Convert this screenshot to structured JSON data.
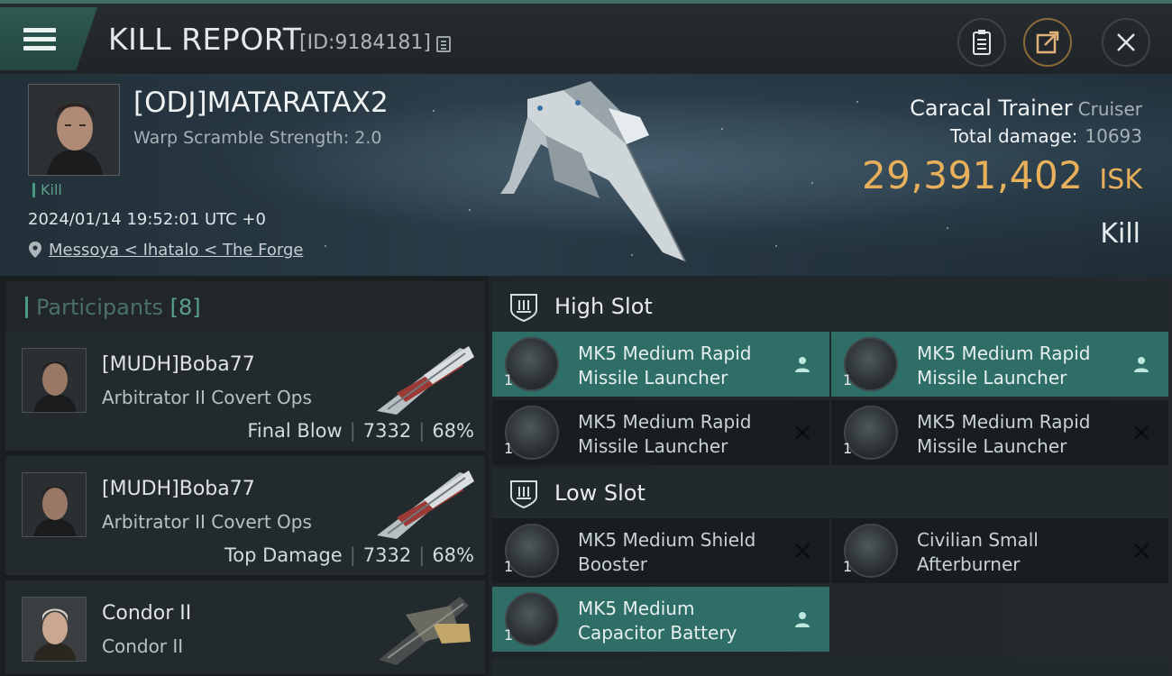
{
  "header": {
    "title": "KILL REPORT",
    "report_id": "[ID:9184181]"
  },
  "victim": {
    "name": "[ODJ]MATARATAX2",
    "warp_scramble": "Warp Scramble Strength: 2.0",
    "tag": "Kill",
    "datetime": "2024/01/14 19:52:01 UTC +0",
    "location": "Messoya < Ihatalo < The Forge",
    "ship_name": "Caracal Trainer",
    "ship_class": "Cruiser",
    "total_damage_label": "Total damage:",
    "total_damage": "10693",
    "isk_value": "29,391,402",
    "isk_unit": "ISK",
    "result": "Kill"
  },
  "participants": {
    "label": "Participants",
    "count": "[8]",
    "items": [
      {
        "name": "[MUDH]Boba77",
        "ship": "Arbitrator II Covert Ops",
        "tag": "Final Blow",
        "damage": "7332",
        "percent": "68%"
      },
      {
        "name": "[MUDH]Boba77",
        "ship": "Arbitrator II Covert Ops",
        "tag": "Top Damage",
        "damage": "7332",
        "percent": "68%"
      },
      {
        "name": "Condor II",
        "ship": "Condor II",
        "tag": "",
        "damage": "",
        "percent": ""
      }
    ]
  },
  "fitting": {
    "high_slot_label": "High Slot",
    "low_slot_label": "Low Slot",
    "high": [
      {
        "qty": "1",
        "line1": "MK5 Medium Rapid",
        "line2": "Missile Launcher",
        "status": "dropped"
      },
      {
        "qty": "1",
        "line1": "MK5 Medium Rapid",
        "line2": "Missile Launcher",
        "status": "dropped"
      },
      {
        "qty": "1",
        "line1": "MK5 Medium Rapid",
        "line2": "Missile Launcher",
        "status": "destroyed"
      },
      {
        "qty": "1",
        "line1": "MK5 Medium Rapid",
        "line2": "Missile Launcher",
        "status": "destroyed"
      }
    ],
    "low": [
      {
        "qty": "1",
        "line1": "MK5 Medium Shield",
        "line2": "Booster",
        "status": "destroyed"
      },
      {
        "qty": "1",
        "line1": "Civilian Small",
        "line2": "Afterburner",
        "status": "destroyed"
      },
      {
        "qty": "1",
        "line1": "MK5 Medium",
        "line2": "Capacitor Battery",
        "status": "dropped"
      }
    ]
  },
  "colors": {
    "accent": "#4b9a7f",
    "highlight_row": "#2e6e67",
    "isk": "#e9b05b"
  },
  "icons": {
    "menu": "hamburger-icon",
    "copy": "copy-icon",
    "clipboard": "clipboard-icon",
    "share": "share-icon",
    "close": "close-icon",
    "location": "location-pin-icon",
    "slot": "slot-shield-icon",
    "dropped": "person-icon",
    "destroyed": "x-icon"
  }
}
